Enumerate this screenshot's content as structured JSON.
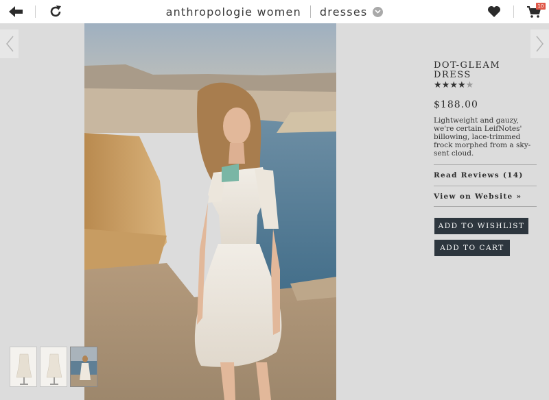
{
  "header": {
    "back_icon": "arrow-left-icon",
    "refresh_icon": "refresh-icon",
    "brand": "anthropologie women",
    "category": "dresses",
    "dropdown_icon": "chevron-down-icon",
    "wishlist_icon": "heart-icon",
    "cart_icon": "cart-icon",
    "cart_count": "10"
  },
  "nav": {
    "prev_icon": "chevron-left-icon",
    "next_icon": "chevron-right-icon"
  },
  "product": {
    "name_line1": "DOT-GLEAM",
    "name_line2": "DRESS",
    "rating": 4,
    "rating_max": 5,
    "price": "$188.00",
    "description": "Lightweight and gauzy, we're certain LeifNotes' billowing, lace-trimmed frock morphed from a sky-sent cloud.",
    "reviews_link": "Read Reviews (14)",
    "website_link": "View on Website »",
    "wishlist_button": "ADD TO WISHLIST",
    "cart_button": "ADD TO CART"
  },
  "thumbnails": [
    "front-view",
    "back-view",
    "model-view"
  ],
  "colors": {
    "accent_dark": "#2d363e",
    "badge": "#e0594a",
    "background": "#dcdcdc"
  }
}
